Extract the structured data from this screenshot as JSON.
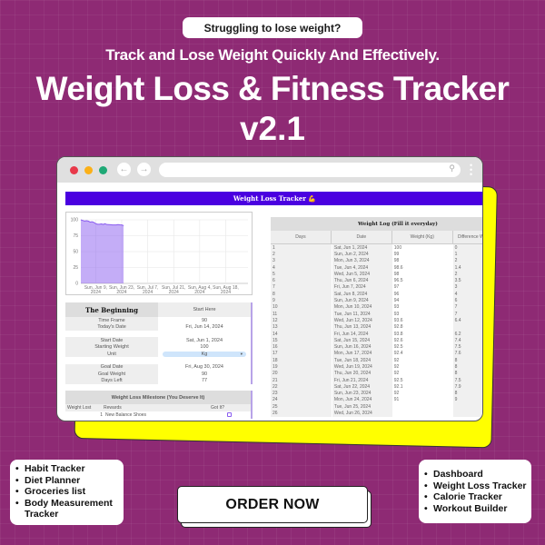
{
  "hero": {
    "pill": "Struggling to lose weight?",
    "subtitle": "Track and Lose Weight Quickly And Effectively.",
    "title": "Weight Loss & Fitness Tracker",
    "version": "v2.1"
  },
  "browser": {
    "banner": "Weight Loss Tracker 💪",
    "back_icon": "←",
    "forward_icon": "→",
    "search_icon": "⚲",
    "menu_icon": "⋮"
  },
  "chart_data": {
    "type": "area",
    "title": "",
    "xlabel": "",
    "ylabel": "",
    "ylim": [
      0,
      100
    ],
    "yticks": [
      "0",
      "25",
      "50",
      "75",
      "100"
    ],
    "xticks": [
      [
        "Sun, Jun 9,",
        "2024"
      ],
      [
        "Sun, Jun 23,",
        "2024"
      ],
      [
        "Sun, Jul 7,",
        "2024"
      ],
      [
        "Sun, Jul 21,",
        "2024"
      ],
      [
        "Sun, Aug 4,",
        "2024"
      ],
      [
        "Sun, Aug 18,",
        "2024"
      ]
    ],
    "x_range_days": [
      1,
      91
    ],
    "x_tick_days": [
      9,
      23,
      37,
      51,
      65,
      79
    ],
    "series": [
      {
        "name": "Weight (Kg)",
        "color": "#8a5cf0",
        "days": [
          1,
          2,
          3,
          4,
          5,
          6,
          7,
          8,
          9,
          10,
          11,
          12,
          13,
          14,
          15,
          16,
          17,
          18,
          19,
          20,
          21,
          22,
          23,
          24
        ],
        "values": [
          100,
          99,
          98,
          98.6,
          98,
          96.5,
          97,
          96,
          94,
          93,
          93,
          93.6,
          92.8,
          93.8,
          92.6,
          92.5,
          92.4,
          92,
          92,
          92,
          92.5,
          92.1,
          92,
          91
        ]
      }
    ],
    "grid": true
  },
  "beginning": {
    "title": "The Beginning",
    "start_label": "Start Here",
    "rows": [
      {
        "k": "Time Frame",
        "v": "90"
      },
      {
        "k": "Today's Date",
        "v": "Fri, Jun 14, 2024"
      },
      {
        "k": "",
        "v": ""
      },
      {
        "k": "Start Date",
        "v": "Sat, Jun 1, 2024"
      },
      {
        "k": "Starting Weight",
        "v": "100"
      },
      {
        "k": "Unit",
        "v": "Kg"
      },
      {
        "k": "",
        "v": ""
      },
      {
        "k": "Goal Date",
        "v": "Fri, Aug 30, 2024"
      },
      {
        "k": "Goal Weight",
        "v": "90"
      },
      {
        "k": "Days Left",
        "v": "77"
      }
    ]
  },
  "milestone": {
    "title": "Weight Loss Milestone (You Deserve It)",
    "cols": [
      "Weight Lost",
      "Rewards",
      "Got It?"
    ],
    "rows": [
      {
        "num": "1",
        "reward": "New Balance Shoes"
      }
    ]
  },
  "log": {
    "title": "Weight Log (Fill it everyday)",
    "cols": [
      "Days",
      "Date",
      "Weight (Kg)",
      "Difference W"
    ],
    "rows": [
      [
        "1",
        "Sat, Jun 1, 2024",
        "100",
        "0"
      ],
      [
        "2",
        "Sun, Jun 2, 2024",
        "99",
        "1"
      ],
      [
        "3",
        "Mon, Jun 3, 2024",
        "98",
        "2"
      ],
      [
        "4",
        "Tue, Jun 4, 2024",
        "98.6",
        "1.4"
      ],
      [
        "5",
        "Wed, Jun 5, 2024",
        "98",
        "2"
      ],
      [
        "6",
        "Thu, Jun 6, 2024",
        "96.5",
        "3.5"
      ],
      [
        "7",
        "Fri, Jun 7, 2024",
        "97",
        "3"
      ],
      [
        "8",
        "Sat, Jun 8, 2024",
        "96",
        "4"
      ],
      [
        "9",
        "Sun, Jun 9, 2024",
        "94",
        "6"
      ],
      [
        "10",
        "Mon, Jun 10, 2024",
        "93",
        "7"
      ],
      [
        "11",
        "Tue, Jun 11, 2024",
        "93",
        "7"
      ],
      [
        "12",
        "Wed, Jun 12, 2024",
        "93.6",
        "6.4"
      ],
      [
        "13",
        "Thu, Jun 13, 2024",
        "92.8",
        ""
      ],
      [
        "14",
        "Fri, Jun 14, 2024",
        "93.8",
        "6.2"
      ],
      [
        "15",
        "Sat, Jun 15, 2024",
        "92.6",
        "7.4"
      ],
      [
        "16",
        "Sun, Jun 16, 2024",
        "92.5",
        "7.5"
      ],
      [
        "17",
        "Mon, Jun 17, 2024",
        "92.4",
        "7.6"
      ],
      [
        "18",
        "Tue, Jun 18, 2024",
        "92",
        "8"
      ],
      [
        "19",
        "Wed, Jun 19, 2024",
        "92",
        "8"
      ],
      [
        "20",
        "Thu, Jun 20, 2024",
        "92",
        "8"
      ],
      [
        "21",
        "Fri, Jun 21, 2024",
        "92.5",
        "7.5"
      ],
      [
        "22",
        "Sat, Jun 22, 2024",
        "92.1",
        "7.9"
      ],
      [
        "23",
        "Sun, Jun 23, 2024",
        "92",
        "8"
      ],
      [
        "24",
        "Mon, Jun 24, 2024",
        "91",
        "9"
      ],
      [
        "25",
        "Tue, Jun 25, 2024",
        "",
        ""
      ],
      [
        "26",
        "Wed, Jun 26, 2024",
        "",
        ""
      ]
    ]
  },
  "left_features": [
    "Habit Tracker",
    "Diet Planner",
    "Groceries list",
    "Body Measurement Tracker"
  ],
  "right_features": [
    "Dashboard",
    "Weight Loss Tracker",
    "Calorie Tracker",
    "Workout Builder"
  ],
  "cta": {
    "label": "ORDER NOW"
  },
  "colors": {
    "background": "#8e2a74",
    "banner": "#4a00e0",
    "accent_yellow": "#ffff00",
    "chart_fill": "#8a5cf0"
  }
}
